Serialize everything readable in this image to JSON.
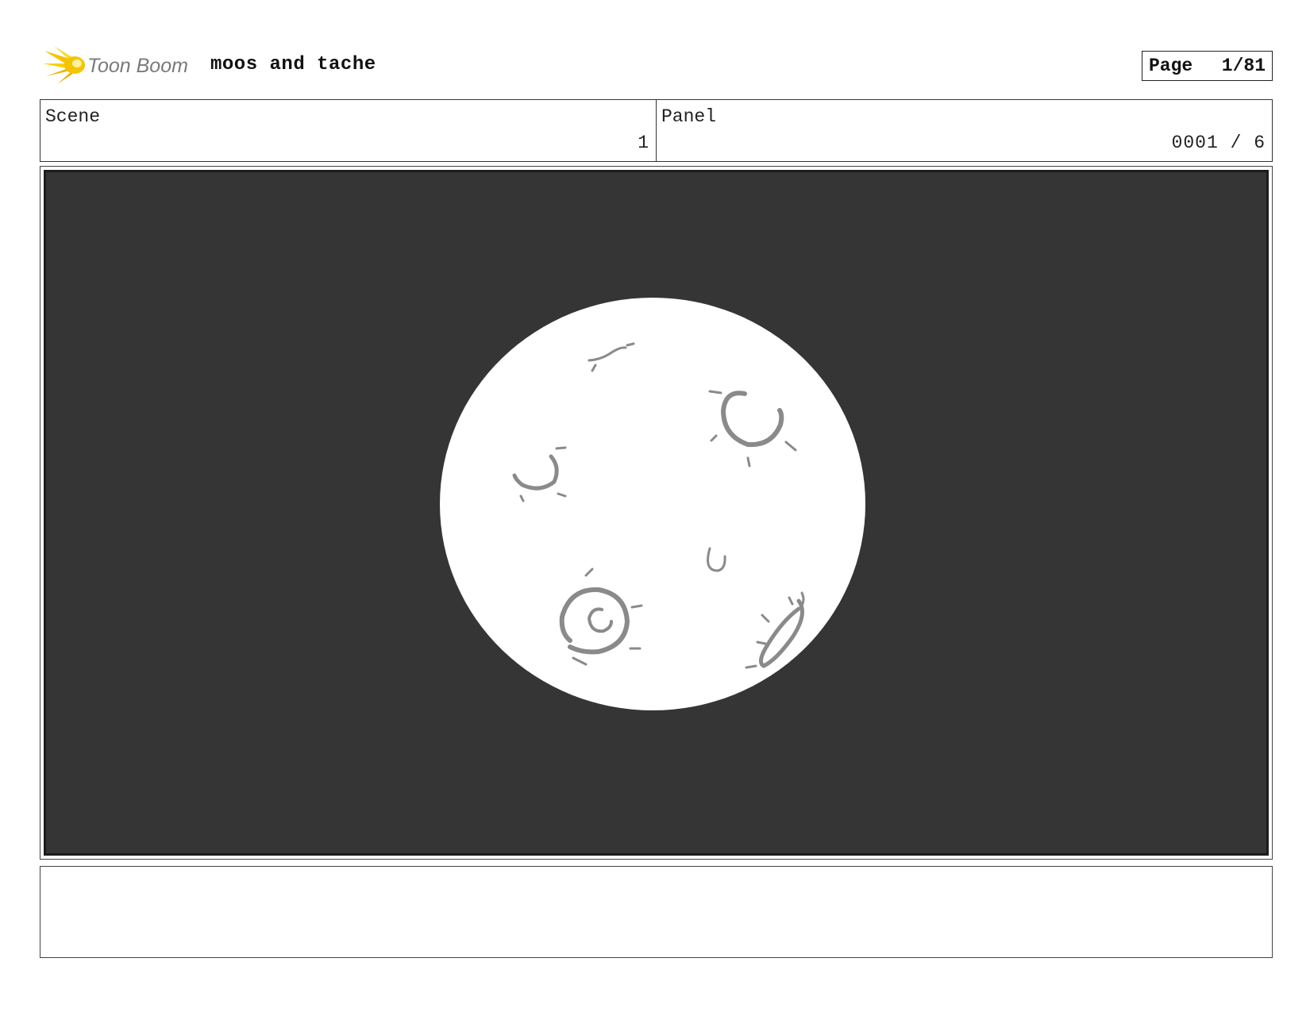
{
  "header": {
    "logo_text": "Toon Boom",
    "project_title": "moos and tache",
    "page_label": "Page",
    "page_number": "1/81"
  },
  "scene": {
    "label": "Scene",
    "value": "1"
  },
  "panel": {
    "label": "Panel",
    "value": "0001 / 6"
  },
  "artwork": {
    "subject_icon": "moon-with-craters",
    "background_color": "#353535",
    "moon_color": "#ffffff",
    "crater_color": "#8a8a8a"
  },
  "notes": {
    "text": ""
  },
  "colors": {
    "logo_yellow": "#f5c400",
    "logo_text": "#7a7a7a"
  }
}
